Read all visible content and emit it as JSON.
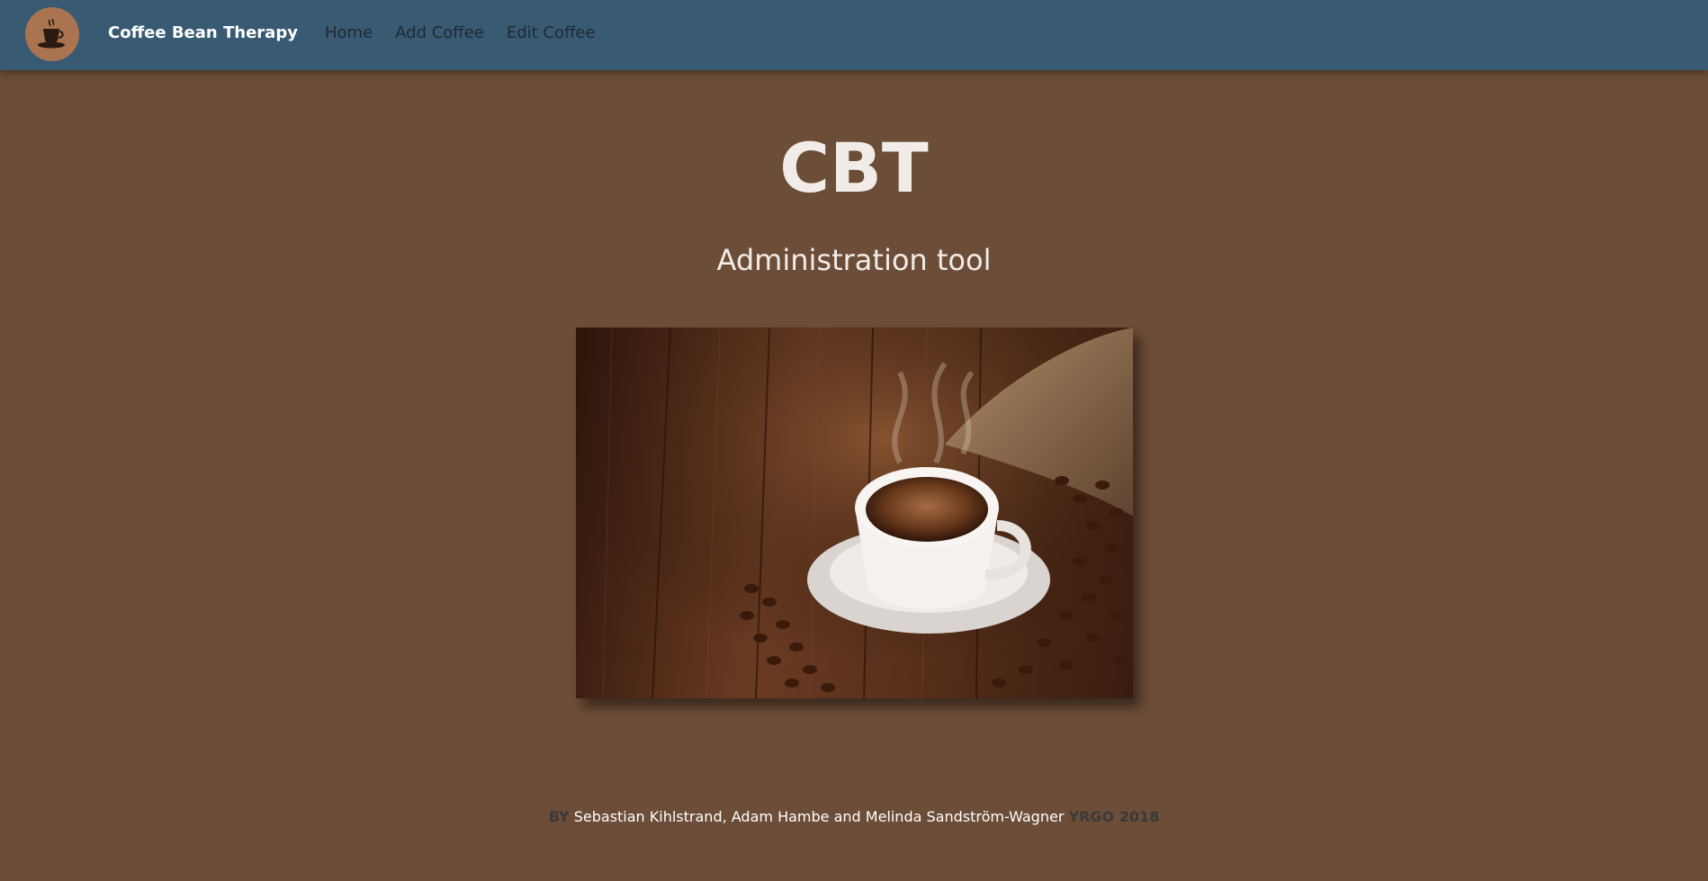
{
  "navbar": {
    "brand": "Coffee Bean Therapy",
    "logo_icon": "coffee-cup-icon",
    "links": [
      "Home",
      "Add Coffee",
      "Edit Coffee"
    ]
  },
  "hero": {
    "title": "CBT",
    "subtitle": "Administration tool",
    "image_subject": "coffee-cup-with-beans-photo"
  },
  "footer": {
    "by_label": "BY",
    "authors": "Sebastian Kihlstrand, Adam Hambe and Melinda Sandström-Wagner",
    "org": "YRGO 2018"
  },
  "colors": {
    "navbar_bg": "#395a73",
    "page_bg": "#6c4d37",
    "logo_bg": "#a9744f",
    "heading_text": "#f1ece7"
  }
}
